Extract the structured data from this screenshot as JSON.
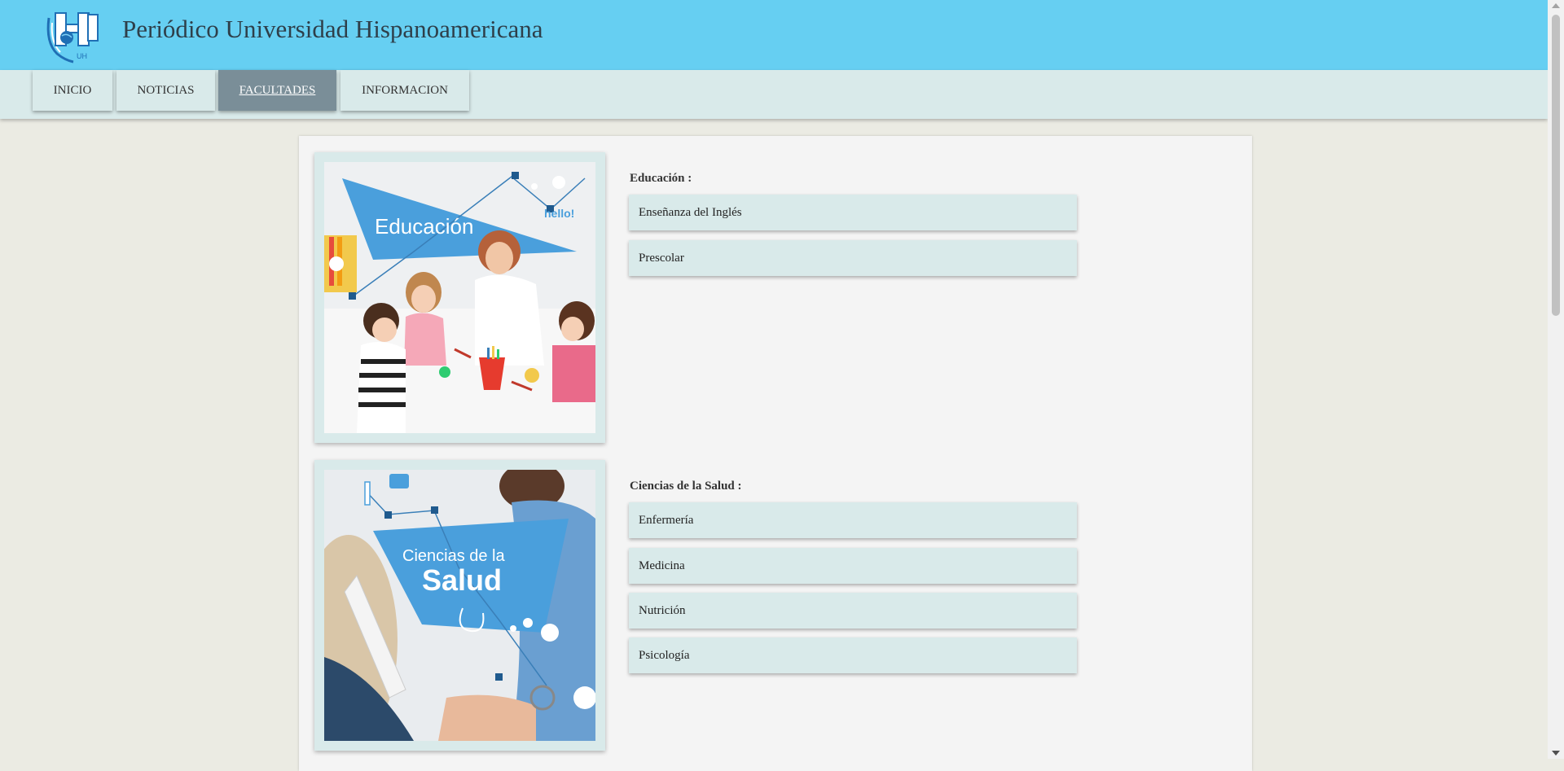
{
  "header": {
    "logo_text": "UH",
    "site_title": "Periódico Universidad Hispanoamericana"
  },
  "nav": [
    {
      "label": "INICIO",
      "active": false
    },
    {
      "label": "NOTICIAS",
      "active": false
    },
    {
      "label": "FACULTADES",
      "active": true
    },
    {
      "label": "INFORMACION",
      "active": false
    }
  ],
  "faculties": [
    {
      "title": "Educación :",
      "banner_text": "Educación",
      "banner_tag": "hello!",
      "careers": [
        "Enseñanza del Inglés",
        "Prescolar"
      ]
    },
    {
      "title": "Ciencias de la Salud :",
      "banner_line1": "Ciencias de la",
      "banner_line2": "Salud",
      "careers": [
        "Enfermería",
        "Medicina",
        "Nutrición",
        "Psicología"
      ]
    }
  ],
  "colors": {
    "header_bg": "#66cff2",
    "nav_bg": "#d9eaea",
    "nav_active_bg": "#7a8e98",
    "page_bg": "#ebebe3",
    "panel_bg": "#f4f4f4",
    "banner_blue": "#4a9fdc"
  }
}
